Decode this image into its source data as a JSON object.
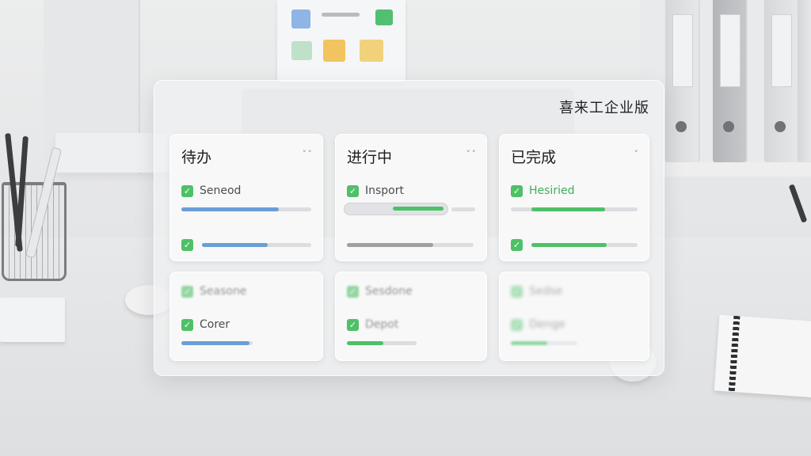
{
  "brand": "喜来工企业版",
  "columns": [
    {
      "title": "待办",
      "chevron": "˅ ˅",
      "top_items": [
        {
          "label": "Seneod",
          "progress": 0.75,
          "color": "blue"
        },
        {
          "label": "",
          "progress": 0.6,
          "color": "blue"
        }
      ],
      "bottom_items": [
        {
          "label": "Seasone",
          "progress": null
        },
        {
          "label": "Corer",
          "progress": 0.95,
          "color": "blue"
        }
      ]
    },
    {
      "title": "进行中",
      "chevron": "˅ ˅",
      "top_items": [
        {
          "label": "Insport",
          "progress": 0.75,
          "color": "green"
        },
        {
          "label": "",
          "progress": 0.68,
          "color": "gray"
        }
      ],
      "bottom_items": [
        {
          "label": "Sesdone",
          "progress": null
        },
        {
          "label": "Depot",
          "progress": 0.52,
          "color": "green"
        }
      ]
    },
    {
      "title": "已完成",
      "chevron": "˅",
      "top_items": [
        {
          "label": "Hesiried",
          "progress": 0.78,
          "color": "green"
        },
        {
          "label": "",
          "progress": 0.71,
          "color": "green"
        }
      ],
      "bottom_items": [
        {
          "label": "Sedse",
          "progress": null
        },
        {
          "label": "Denge",
          "progress": 0.55,
          "color": "green"
        }
      ]
    }
  ],
  "check_glyph": "✓"
}
